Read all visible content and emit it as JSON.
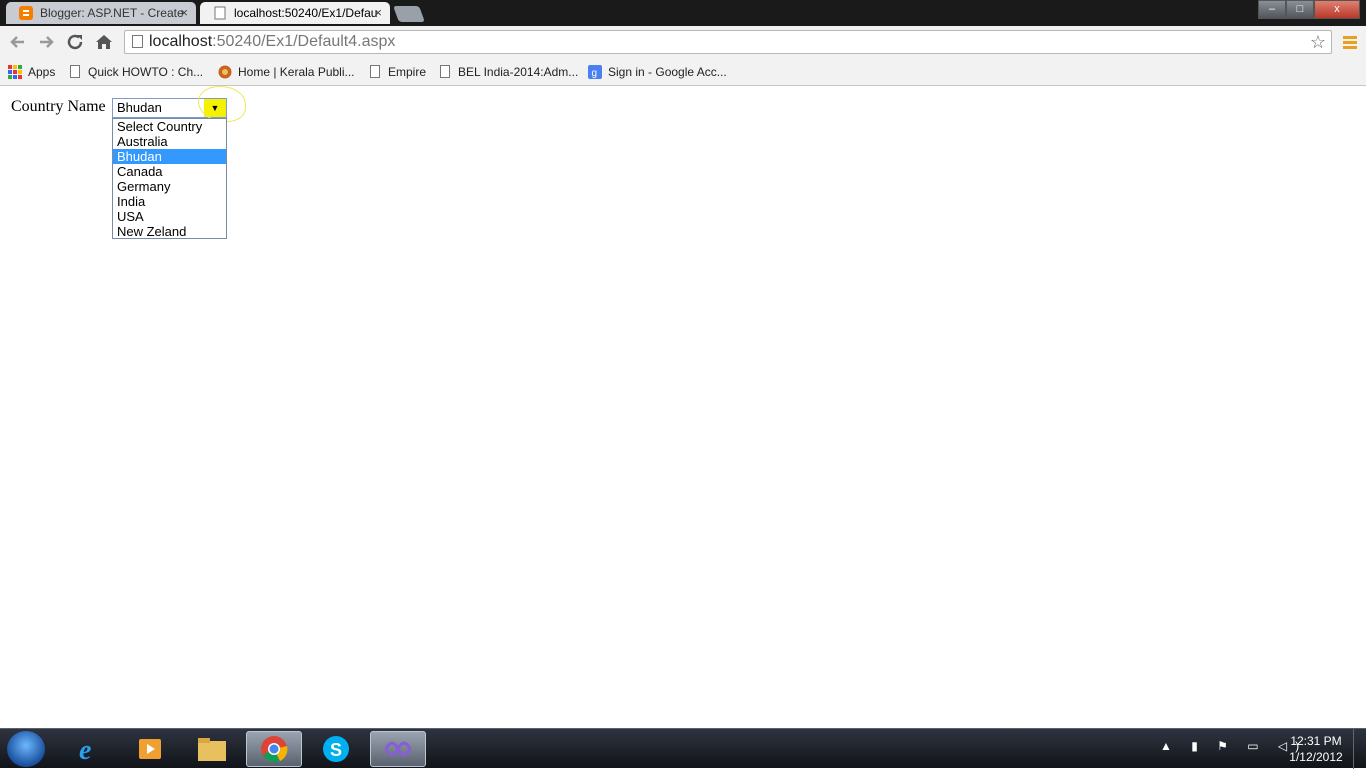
{
  "browser": {
    "tabs": [
      {
        "title": "Blogger: ASP.NET - Create",
        "active": false
      },
      {
        "title": "localhost:50240/Ex1/Defau",
        "active": true
      }
    ],
    "tab_close_glyph": "×",
    "url_host": "localhost",
    "url_path": ":50240/Ex1/Default4.aspx",
    "window_buttons": {
      "minimize": "–",
      "maximize": "□",
      "close": "x"
    },
    "bookmarks": [
      {
        "label": "Apps",
        "icon": "apps-grid-icon"
      },
      {
        "label": "Quick HOWTO : Ch...",
        "icon": "page-icon"
      },
      {
        "label": "Home | Kerala Publi...",
        "icon": "kerala-logo-icon"
      },
      {
        "label": "Empire",
        "icon": "page-icon"
      },
      {
        "label": "BEL India-2014:Adm...",
        "icon": "page-icon"
      },
      {
        "label": "Sign in - Google Acc...",
        "icon": "google-icon"
      }
    ]
  },
  "form": {
    "label": "Country Name",
    "selected": "Bhudan",
    "arrow_glyph": "▼",
    "options": [
      "Select Country",
      "Australia",
      "Bhudan",
      "Canada",
      "Germany",
      "India",
      "USA",
      "New Zeland"
    ],
    "highlighted_index": 2
  },
  "taskbar": {
    "apps": [
      "internet-explorer",
      "media-player",
      "file-explorer",
      "chrome",
      "skype",
      "visual-studio"
    ],
    "time": "12:31 PM",
    "date": "1/12/2012"
  },
  "colors": {
    "selection": "#3399ff",
    "arrow_highlight": "#f5f200"
  }
}
